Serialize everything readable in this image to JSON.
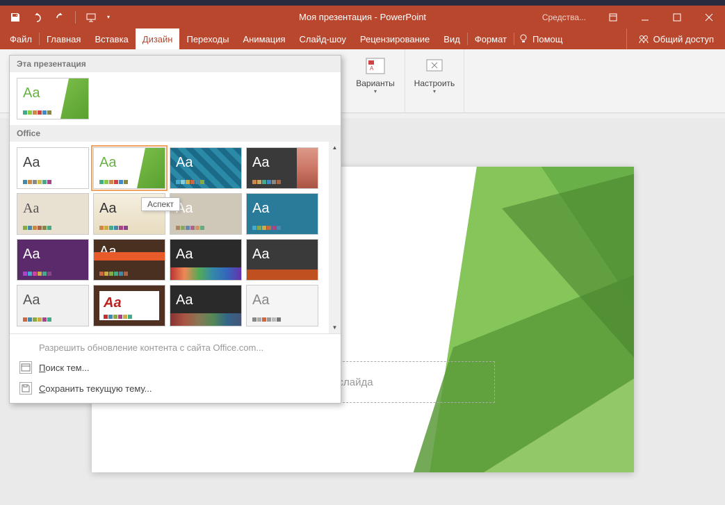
{
  "titlebar": {
    "title": "Моя презентация - PowerPoint",
    "tools": "Средства..."
  },
  "tabs": {
    "file": "Файл",
    "home": "Главная",
    "insert": "Вставка",
    "design": "Дизайн",
    "transitions": "Переходы",
    "animations": "Анимация",
    "slideshow": "Слайд-шоу",
    "review": "Рецензирование",
    "view": "Вид",
    "format": "Формат",
    "help": "Помощ",
    "share": "Общий доступ"
  },
  "ribbon": {
    "variants": "Варианты",
    "customize": "Настроить"
  },
  "panel": {
    "section_this": "Эта презентация",
    "section_office": "Office",
    "tooltip": "Аспект",
    "update_link": "Разрешить обновление контента с сайта Office.com...",
    "search": "Поиск тем...",
    "save_theme": "Сохранить текущую тему...",
    "search_u": "П",
    "save_u": "С"
  },
  "slide": {
    "subtitle": "Подзаголовок слайда"
  }
}
